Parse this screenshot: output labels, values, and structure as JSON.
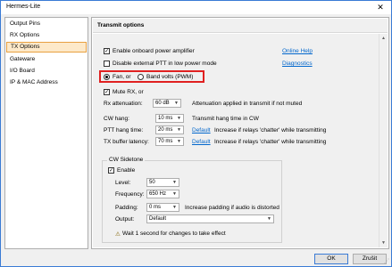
{
  "window": {
    "title": "Hermes-Lite",
    "close": "✕"
  },
  "sidebar": {
    "items": [
      {
        "label": "Output Pins",
        "selected": false
      },
      {
        "label": "RX Options",
        "selected": false
      },
      {
        "label": "TX Options",
        "selected": true
      },
      {
        "label": "Gateware",
        "selected": false
      },
      {
        "label": "I/O Board",
        "selected": false
      },
      {
        "label": "IP & MAC Address",
        "selected": false
      }
    ]
  },
  "section": {
    "title": "Transmit options"
  },
  "options": {
    "enable_pa": {
      "label": "Enable onboard power amplifier",
      "checked": true
    },
    "disable_ptt": {
      "label": "Disable external PTT in low power mode",
      "checked": false
    },
    "fan": {
      "label": "Fan, or",
      "selected": true
    },
    "band_volts": {
      "label": "Band volts (PWM)",
      "selected": false
    },
    "mute_rx": {
      "label": "Mute RX, or",
      "checked": true
    }
  },
  "links": {
    "online_help": "Online Help",
    "diagnostics": "Diagnostics"
  },
  "rx_attenuation": {
    "label": "Rx attenuation:",
    "value": "60 dB",
    "note": "Attenuation applied in transmit if not muted"
  },
  "cw_hang": {
    "label": "CW hang:",
    "value": "10 ms",
    "note": "Transmit hang time in CW"
  },
  "ptt_hang": {
    "label": "PTT hang time:",
    "value": "20 ms",
    "default": "Default",
    "note": "Increase if relays 'chatter' while transmitting"
  },
  "tx_buffer": {
    "label": "TX buffer latency:",
    "value": "70 ms",
    "default": "Default",
    "note": "Increase if relays 'chatter' while transmitting"
  },
  "cw_sidetone": {
    "title": "CW Sidetone",
    "enable": {
      "label": "Enable",
      "checked": true
    },
    "level": {
      "label": "Level:",
      "value": "50"
    },
    "frequency": {
      "label": "Frequency:",
      "value": "650 Hz"
    },
    "padding": {
      "label": "Padding:",
      "value": "0 ms",
      "note": "Increase padding if audio is distorted"
    },
    "output": {
      "label": "Output:",
      "value": "Default"
    },
    "warning": "Wait 1 second for changes to take effect",
    "warning_icon": "⚠"
  },
  "buttons": {
    "ok": "OK",
    "cancel": "Zrušit"
  },
  "colors": {
    "selection_bg": "#fde9c9",
    "selection_border": "#e8a040",
    "highlight": "#e02020",
    "link": "#0066cc"
  }
}
